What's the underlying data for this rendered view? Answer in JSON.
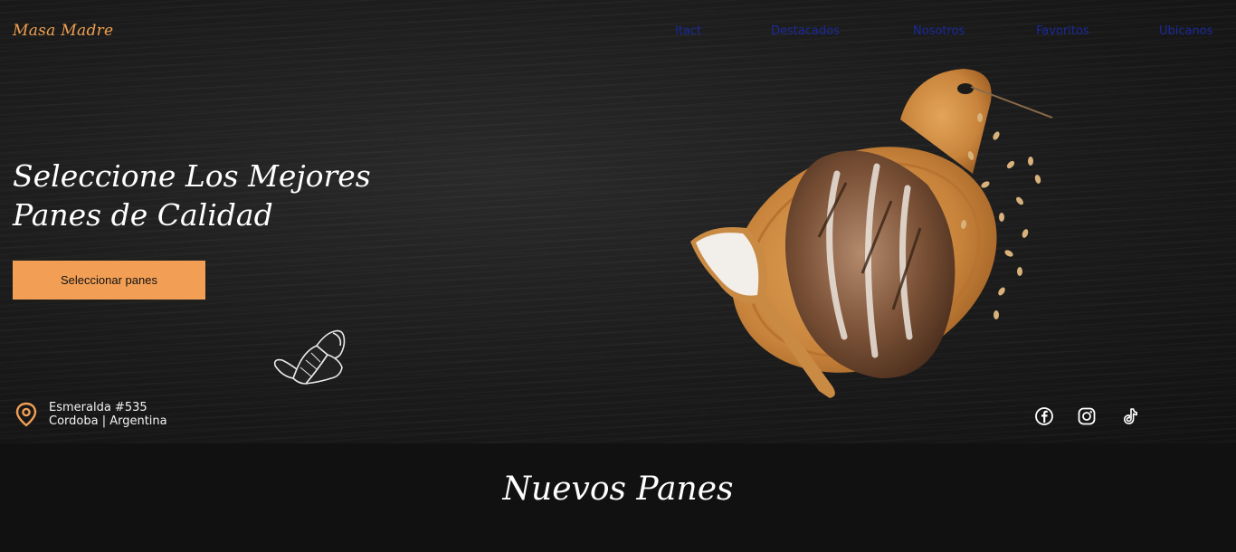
{
  "brand": {
    "name": "Masa Madre"
  },
  "nav": {
    "items": [
      {
        "label": "Itact"
      },
      {
        "label": "Destacados"
      },
      {
        "label": "Nosotros"
      },
      {
        "label": "Favoritos"
      },
      {
        "label": "Ubicanos"
      }
    ]
  },
  "hero": {
    "headline_line1": "Seleccione Los Mejores",
    "headline_line2": "Panes de Calidad",
    "cta_label": "Seleccionar panes"
  },
  "address": {
    "line1": "Esmeralda #535",
    "line2": "Cordoba | Argentina"
  },
  "social": {
    "icons": [
      "facebook-icon",
      "instagram-icon",
      "tiktok-icon"
    ]
  },
  "section": {
    "title": "Nuevos Panes"
  },
  "colors": {
    "accent": "#f29f55",
    "brand": "#f0a050",
    "nav_link": "#1a2a9a",
    "background": "#101010"
  }
}
